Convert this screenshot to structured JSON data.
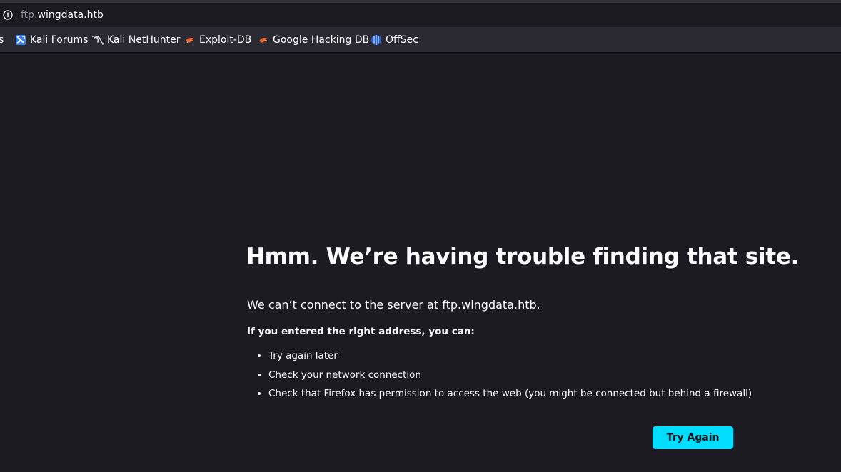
{
  "browser": {
    "url": {
      "subdomain": "ftp.",
      "domain": "wingdata.htb"
    },
    "bookmarks": [
      {
        "label": "s",
        "icon": "cut-off-icon"
      },
      {
        "label": "Kali Forums",
        "icon": "kali-forums-icon"
      },
      {
        "label": "Kali NetHunter",
        "icon": "kali-dragon-icon"
      },
      {
        "label": "Exploit-DB",
        "icon": "exploit-db-icon"
      },
      {
        "label": "Google Hacking DB",
        "icon": "ghdb-icon"
      },
      {
        "label": "OffSec",
        "icon": "offsec-icon"
      }
    ]
  },
  "error_page": {
    "title": "Hmm. We’re having trouble finding that site.",
    "description": "We can’t connect to the server at ftp.wingdata.htb.",
    "subheading": "If you entered the right address, you can:",
    "tips": [
      "Try again later",
      "Check your network connection",
      "Check that Firefox has permission to access the web (you might be connected but behind a firewall)"
    ],
    "button_label": "Try Again"
  },
  "colors": {
    "page_background": "#1c1b22",
    "toolbar_background": "#2b2a33",
    "button_accent": "#00ddff",
    "text": "#fbfbfe"
  }
}
